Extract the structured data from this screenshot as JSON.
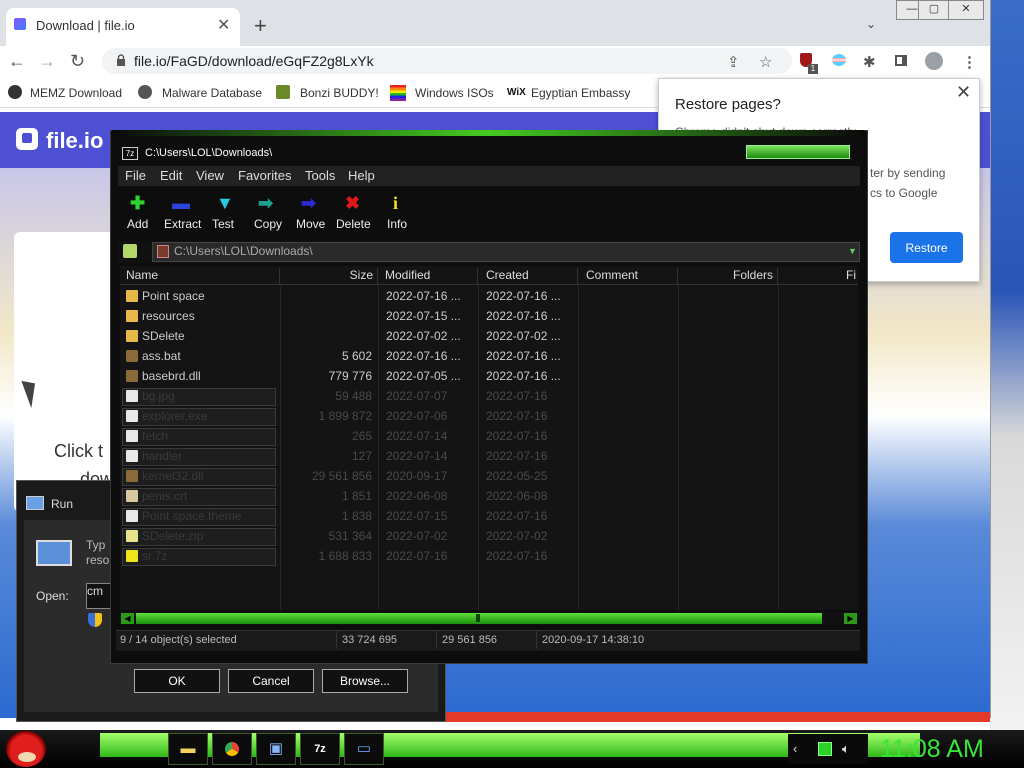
{
  "browser": {
    "tab_title": "Download | file.io",
    "tab_close": "✕",
    "new_tab": "+",
    "url": "file.io/FaGD/download/eGqFZ2g8LxYk",
    "window_controls": [
      "—",
      "▢",
      "✕"
    ],
    "bookmarks": [
      {
        "label": "MEMZ Download",
        "icon": "github-icon"
      },
      {
        "label": "Malware Database",
        "icon": "globe-icon"
      },
      {
        "label": "Bonzi BUDDY!",
        "icon": "bonzi-icon"
      },
      {
        "label": "Windows ISOs",
        "icon": "windows-icon"
      },
      {
        "label": "Egyptian Embassy",
        "icon": "wix-icon"
      }
    ],
    "extension_badge": "1"
  },
  "page": {
    "logo": "file.io",
    "click_text": "Click t",
    "dow_text": "dow"
  },
  "restore_popup": {
    "title": "Restore pages?",
    "body1": "Chrome didn't shut down correctly.",
    "body2": "ter by sending",
    "body3": "cs to Google",
    "button": "Restore"
  },
  "run_dialog": {
    "title": "Run",
    "text1": "Typ",
    "text2": "reso",
    "open_label": "Open:",
    "input_value": "cm",
    "buttons": {
      "ok": "OK",
      "cancel": "Cancel",
      "browse": "Browse..."
    }
  },
  "sevenzip": {
    "title": "C:\\Users\\LOL\\Downloads\\",
    "title_icon": "7z",
    "menu": [
      "File",
      "Edit",
      "View",
      "Favorites",
      "Tools",
      "Help"
    ],
    "toolbar": [
      {
        "label": "Add",
        "glyph": "✚",
        "color": "#2fd32f"
      },
      {
        "label": "Extract",
        "glyph": "▬",
        "color": "#2a45d8"
      },
      {
        "label": "Test",
        "glyph": "▼",
        "color": "#28c8e0"
      },
      {
        "label": "Copy",
        "glyph": "➡",
        "color": "#1ea090"
      },
      {
        "label": "Move",
        "glyph": "➡",
        "color": "#2a2ad0"
      },
      {
        "label": "Delete",
        "glyph": "✖",
        "color": "#e01818"
      },
      {
        "label": "Info",
        "glyph": "i",
        "color": "#f2e21a"
      }
    ],
    "path": "C:\\Users\\LOL\\Downloads\\",
    "columns": [
      "Name",
      "Size",
      "Modified",
      "Created",
      "Comment",
      "Folders",
      "Fi"
    ],
    "rows": [
      {
        "name": "Point space",
        "size": "",
        "modified": "2022-07-16 ...",
        "created": "2022-07-16 ...",
        "selected": false,
        "icon": "folder"
      },
      {
        "name": "resources",
        "size": "",
        "modified": "2022-07-15 ...",
        "created": "2022-07-16 ...",
        "selected": false,
        "icon": "folder"
      },
      {
        "name": "SDelete",
        "size": "",
        "modified": "2022-07-02 ...",
        "created": "2022-07-02 ...",
        "selected": false,
        "icon": "folder"
      },
      {
        "name": "ass.bat",
        "size": "5 602",
        "modified": "2022-07-16 ...",
        "created": "2022-07-16 ...",
        "selected": false,
        "icon": "bat"
      },
      {
        "name": "basebrd.dll",
        "size": "779 776",
        "modified": "2022-07-05 ...",
        "created": "2022-07-16 ...",
        "selected": false,
        "icon": "dll"
      },
      {
        "name": "bg.jpg",
        "size": "59 488",
        "modified": "2022-07-07",
        "created": "2022-07-16",
        "selected": true,
        "icon": "file"
      },
      {
        "name": "explorer.exe",
        "size": "1 899 872",
        "modified": "2022-07-06",
        "created": "2022-07-16",
        "selected": true,
        "icon": "file"
      },
      {
        "name": "fetch",
        "size": "265",
        "modified": "2022-07-14",
        "created": "2022-07-16",
        "selected": true,
        "icon": "file"
      },
      {
        "name": "handler",
        "size": "127",
        "modified": "2022-07-14",
        "created": "2022-07-16",
        "selected": true,
        "icon": "file"
      },
      {
        "name": "kernel32.dll",
        "size": "29 561 856",
        "modified": "2020-09-17",
        "created": "2022-05-25",
        "selected": true,
        "icon": "dll"
      },
      {
        "name": "penis.crt",
        "size": "1 851",
        "modified": "2022-06-08",
        "created": "2022-06-08",
        "selected": true,
        "icon": "cert"
      },
      {
        "name": "Point space.theme",
        "size": "1 838",
        "modified": "2022-07-15",
        "created": "2022-07-16",
        "selected": true,
        "icon": "file"
      },
      {
        "name": "SDelete.zip",
        "size": "531 364",
        "modified": "2022-07-02",
        "created": "2022-07-02",
        "selected": true,
        "icon": "zip"
      },
      {
        "name": "sr.7z",
        "size": "1 688 833",
        "modified": "2022-07-16",
        "created": "2022-07-16",
        "selected": true,
        "icon": "7z"
      }
    ],
    "status": {
      "selection": "9 / 14 object(s) selected",
      "total_size": "33 724 695",
      "selected_size": "29 561 856",
      "date": "2020-09-17 14:38:10"
    }
  },
  "taskbar": {
    "clock": "11:08 AM",
    "apps": [
      "folder-icon",
      "chrome-icon",
      "explorer-icon",
      "7zip-icon",
      "run-icon"
    ]
  }
}
